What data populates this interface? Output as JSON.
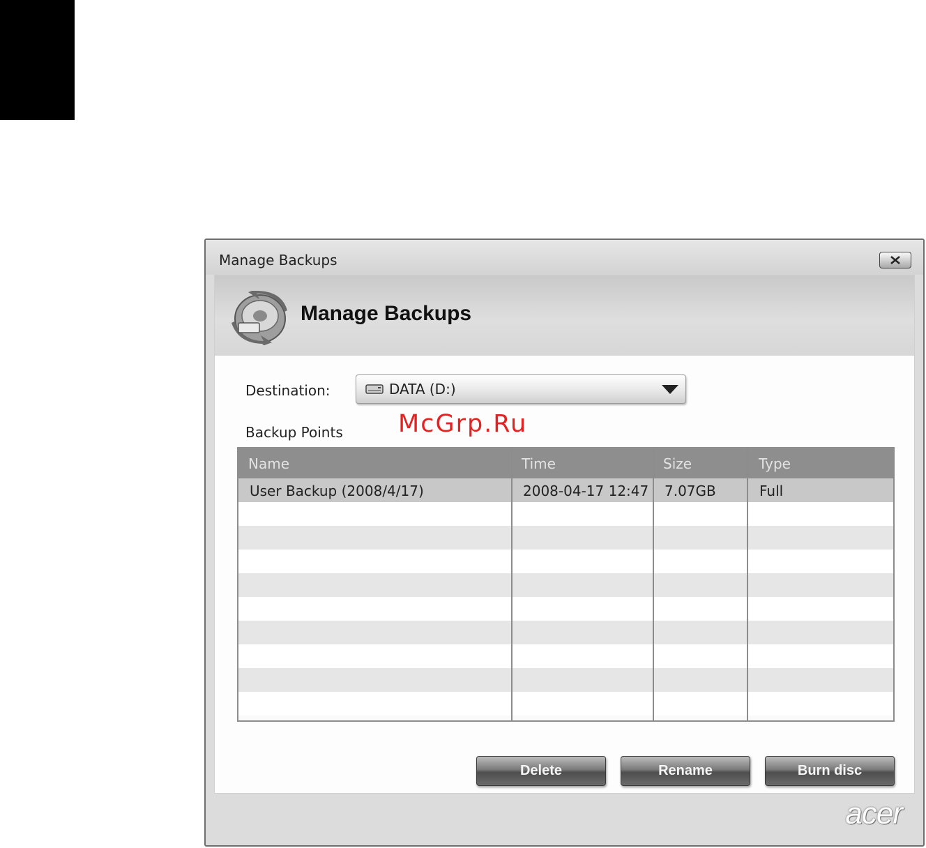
{
  "watermark": "McGrp.Ru",
  "window": {
    "title": "Manage Backups",
    "header_title": "Manage Backups",
    "icons": {
      "close": "close-icon",
      "header": "backup-disk-icon",
      "drive": "hard-drive-icon",
      "dropdown": "chevron-down-icon"
    }
  },
  "destination": {
    "label": "Destination:",
    "value": "DATA (D:)"
  },
  "backup_points": {
    "label": "Backup Points",
    "columns": [
      "Name",
      "Time",
      "Size",
      "Type"
    ],
    "rows": [
      {
        "name": "User Backup (2008/4/17)",
        "time": "2008-04-17 12:47",
        "size": "7.07GB",
        "type": "Full"
      }
    ]
  },
  "buttons": {
    "delete": "Delete",
    "rename": "Rename",
    "burn": "Burn disc"
  },
  "logo": "acer"
}
